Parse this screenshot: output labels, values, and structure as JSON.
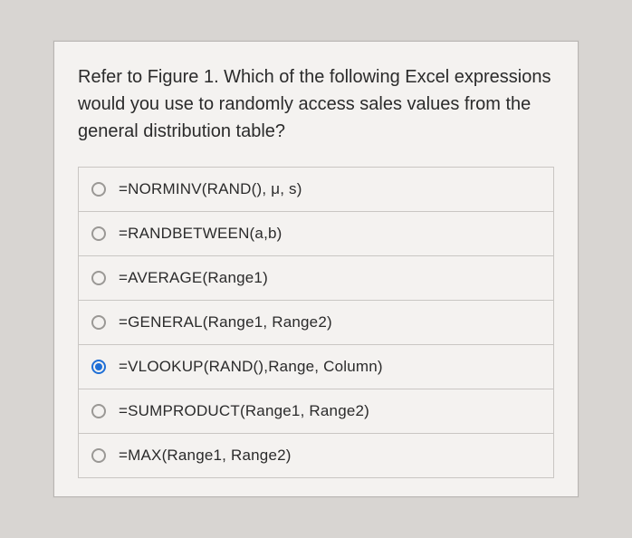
{
  "question": "Refer to Figure 1. Which of the following Excel expressions would you use to randomly access sales values from the general distribution table?",
  "options": [
    {
      "label": "=NORMINV(RAND(), μ, s)",
      "selected": false
    },
    {
      "label": "=RANDBETWEEN(a,b)",
      "selected": false
    },
    {
      "label": "=AVERAGE(Range1)",
      "selected": false
    },
    {
      "label": "=GENERAL(Range1, Range2)",
      "selected": false
    },
    {
      "label": "=VLOOKUP(RAND(),Range, Column)",
      "selected": true
    },
    {
      "label": "=SUMPRODUCT(Range1, Range2)",
      "selected": false
    },
    {
      "label": "=MAX(Range1, Range2)",
      "selected": false
    }
  ]
}
